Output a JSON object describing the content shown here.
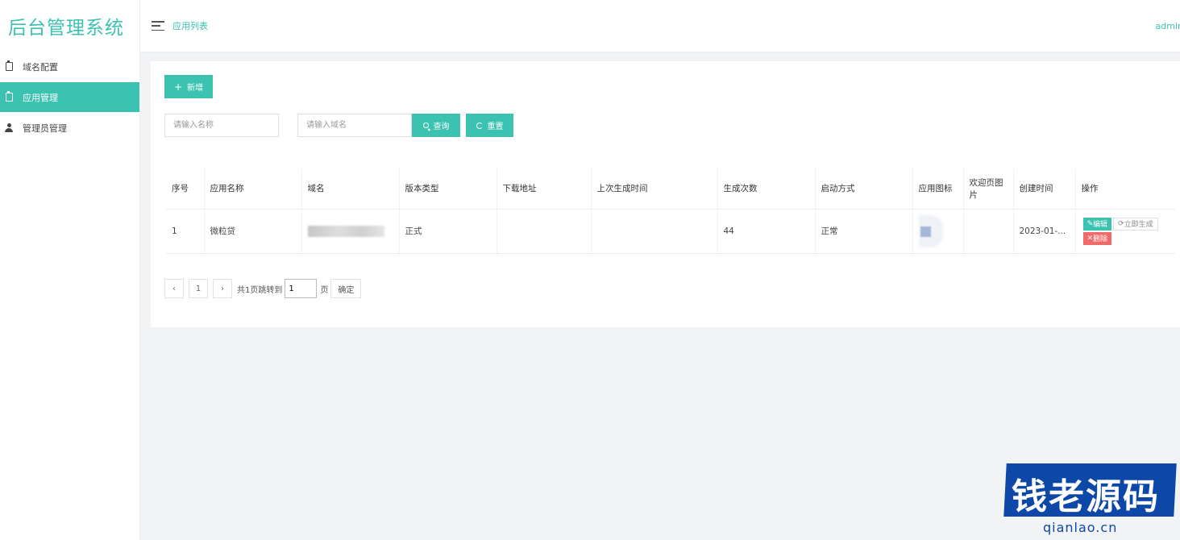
{
  "sidebar": {
    "brand": "后台管理系统",
    "items": [
      {
        "label": "域名配置",
        "icon": "clipboard-icon",
        "active": false
      },
      {
        "label": "应用管理",
        "icon": "clipboard-icon",
        "active": true
      },
      {
        "label": "管理员管理",
        "icon": "user-icon",
        "active": false
      }
    ]
  },
  "header": {
    "breadcrumb": "应用列表",
    "user": "admin"
  },
  "toolbar": {
    "add_label": "新增",
    "name_placeholder": "请输入名称",
    "domain_placeholder": "请输入域名",
    "search_label": "查询",
    "reset_label": "重置"
  },
  "table": {
    "headers": [
      "序号",
      "应用名称",
      "域名",
      "版本类型",
      "下载地址",
      "上次生成时间",
      "生成次数",
      "启动方式",
      "应用图标",
      "欢迎页图片",
      "创建时间",
      "操作"
    ],
    "rows": [
      {
        "index": "1",
        "name": "微粒贷",
        "domain": "",
        "version_type": "正式",
        "download_url": "",
        "last_generated": "",
        "generate_count": "44",
        "launch_mode": "正常",
        "welcome_image": "",
        "created_at": "2023-01-...",
        "actions": {
          "edit": "编辑",
          "generate": "立即生成",
          "delete": "删除"
        }
      }
    ]
  },
  "pagination": {
    "prev": "‹",
    "current_page": "1",
    "next": "›",
    "total_text": "共1页",
    "jump_text": "跳转到",
    "jump_value": "1",
    "page_unit": "页",
    "confirm": "确定"
  },
  "watermark": {
    "title": "钱老源码",
    "subtitle": "qianlao.cn"
  },
  "colors": {
    "accent": "#3cc2b0",
    "danger": "#ef6b6b",
    "watermark": "#0d47a8"
  }
}
